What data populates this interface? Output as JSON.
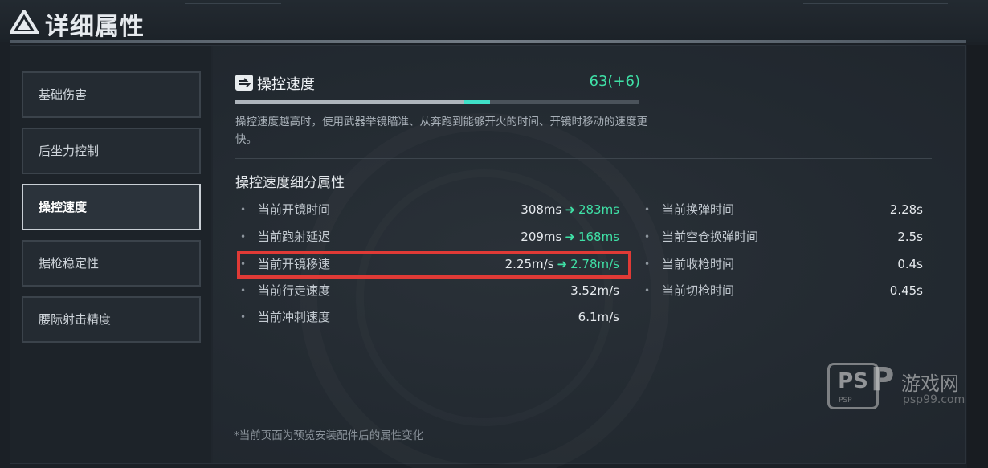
{
  "header": {
    "title": "详细属性",
    "icon": "delta-logo-icon"
  },
  "sidebar": {
    "items": [
      {
        "label": "基础伤害",
        "active": false
      },
      {
        "label": "后坐力控制",
        "active": false
      },
      {
        "label": "操控速度",
        "active": true
      },
      {
        "label": "据枪稳定性",
        "active": false
      },
      {
        "label": "腰际射击精度",
        "active": false
      }
    ]
  },
  "stat": {
    "icon": "handling-icon",
    "name": "操控速度",
    "value": "63(+6)",
    "bar_base_fraction": 0.567,
    "bar_bonus_fraction": 0.064,
    "description": "操控速度越高时，使用武器举镜瞄准、从奔跑到能够开火的时间、开镜时移动的速度更快。"
  },
  "breakdown": {
    "title": "操控速度细分属性",
    "left": [
      {
        "label": "当前开镜时间",
        "old": "308ms",
        "new": "283ms"
      },
      {
        "label": "当前跑射延迟",
        "old": "209ms",
        "new": "168ms"
      },
      {
        "label": "当前开镜移速",
        "old": "2.25m/s",
        "new": "2.78m/s"
      },
      {
        "label": "当前行走速度",
        "old": "3.52m/s",
        "new": ""
      },
      {
        "label": "当前冲刺速度",
        "old": "6.1m/s",
        "new": ""
      }
    ],
    "right": [
      {
        "label": "当前换弹时间",
        "old": "2.28s",
        "new": ""
      },
      {
        "label": "当前空仓换弹时间",
        "old": "2.5s",
        "new": ""
      },
      {
        "label": "当前收枪时间",
        "old": "0.4s",
        "new": ""
      },
      {
        "label": "当前切枪时间",
        "old": "0.45s",
        "new": ""
      }
    ]
  },
  "footnote": "*当前页面为预览安装配件后的属性变化",
  "watermark": {
    "box": "PS",
    "p": "P",
    "text": "游戏网",
    "url": "psp99.com",
    "small": "PSP"
  },
  "colors": {
    "accent_green": "#3fe0a6",
    "highlight_red": "#e03a36"
  }
}
